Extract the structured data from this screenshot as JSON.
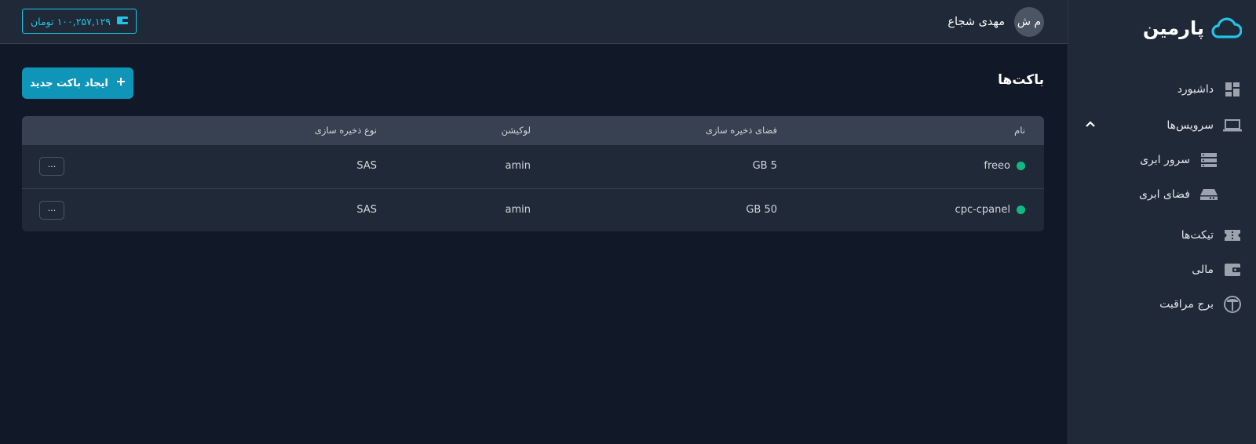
{
  "brand": {
    "name": "پارمین",
    "icon": "cloud-icon"
  },
  "sidebar": {
    "items": [
      {
        "label": "داشبورد",
        "icon": "dashboard-icon"
      },
      {
        "label": "سرویس‌ها",
        "icon": "laptop-icon",
        "expanded": true
      },
      {
        "label": "سرور ابری",
        "icon": "server-icon"
      },
      {
        "label": "فضای ابری",
        "icon": "hard-drive-icon"
      },
      {
        "label": "تیکت‌ها",
        "icon": "ticket-icon"
      },
      {
        "label": "مالی",
        "icon": "wallet-icon"
      },
      {
        "label": "برج مراقبت",
        "icon": "tower-icon"
      }
    ]
  },
  "header": {
    "wallet_label": "۱۰۰,۲۵۷,۱۲۹ تومان",
    "user_initials": "م ش",
    "user_name": "مهدی شجاع"
  },
  "main": {
    "title": "باکت‌ها",
    "create_button": "ایجاد باکت جدید",
    "columns": {
      "name": "نام",
      "space": "فضای ذخیره سازی",
      "location": "لوکیشن",
      "type": "نوع ذخیره سازی"
    },
    "rows": [
      {
        "name": "freeo",
        "space": "5 GB",
        "location": "amin",
        "type": "SAS",
        "more": "···"
      },
      {
        "name": "cpc-cpanel",
        "space": "50 GB",
        "location": "amin",
        "type": "SAS",
        "more": "···"
      }
    ]
  },
  "colors": {
    "accent": "#0e95b8",
    "wallet": "#22c3e6",
    "status_active": "#10b981",
    "background": "#111827",
    "panel": "#1f2937"
  }
}
